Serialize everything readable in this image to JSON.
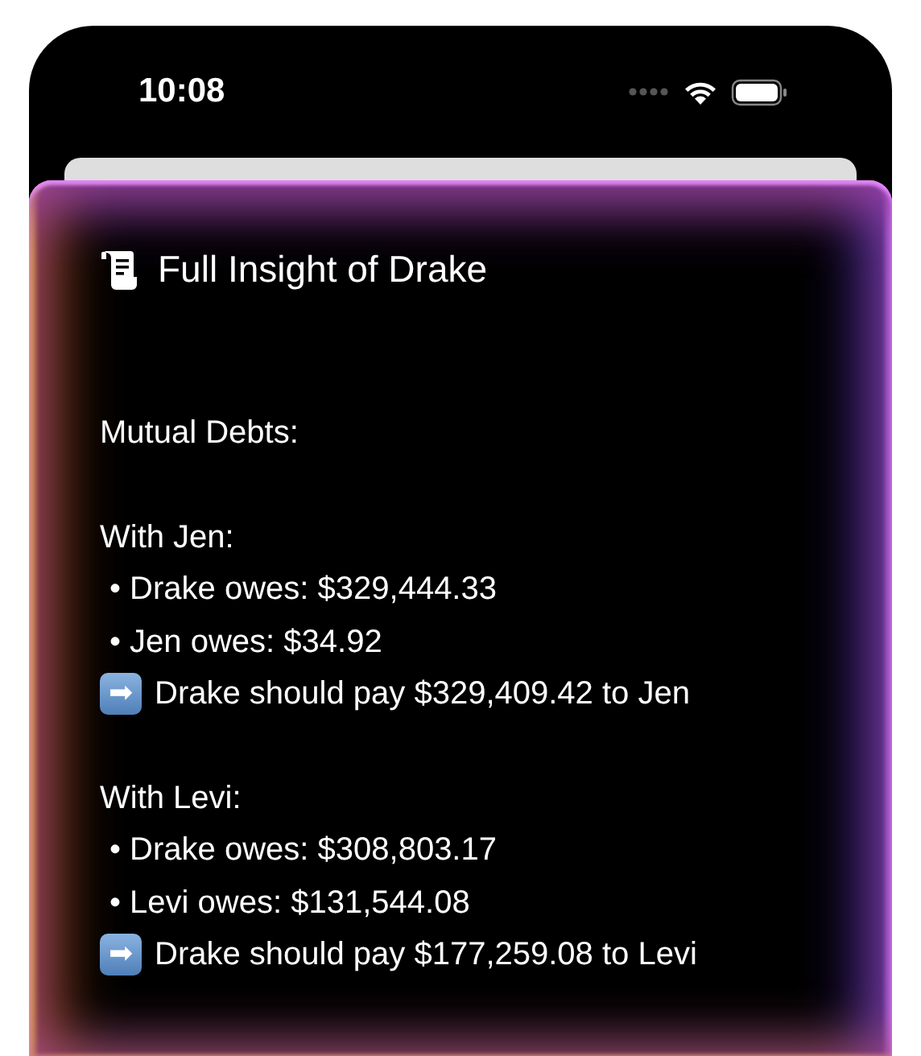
{
  "status_bar": {
    "time": "10:08"
  },
  "card": {
    "title": "Full Insight of Drake",
    "lines": [
      {
        "kind": "heading",
        "text": "Mutual Debts:"
      },
      {
        "kind": "blank"
      },
      {
        "kind": "heading",
        "text": "With Jen:"
      },
      {
        "kind": "bullet",
        "text": "• Drake owes: $329,444.33"
      },
      {
        "kind": "bullet",
        "text": "• Jen owes: $34.92"
      },
      {
        "kind": "result",
        "icon": "➡",
        "text": "Drake should pay $329,409.42 to Jen"
      },
      {
        "kind": "blank"
      },
      {
        "kind": "heading",
        "text": "With Levi:"
      },
      {
        "kind": "bullet",
        "text": "• Drake owes: $308,803.17"
      },
      {
        "kind": "bullet",
        "text": "• Levi owes: $131,544.08"
      },
      {
        "kind": "result",
        "icon": "➡",
        "text": "Drake should pay $177,259.08 to Levi"
      }
    ]
  }
}
